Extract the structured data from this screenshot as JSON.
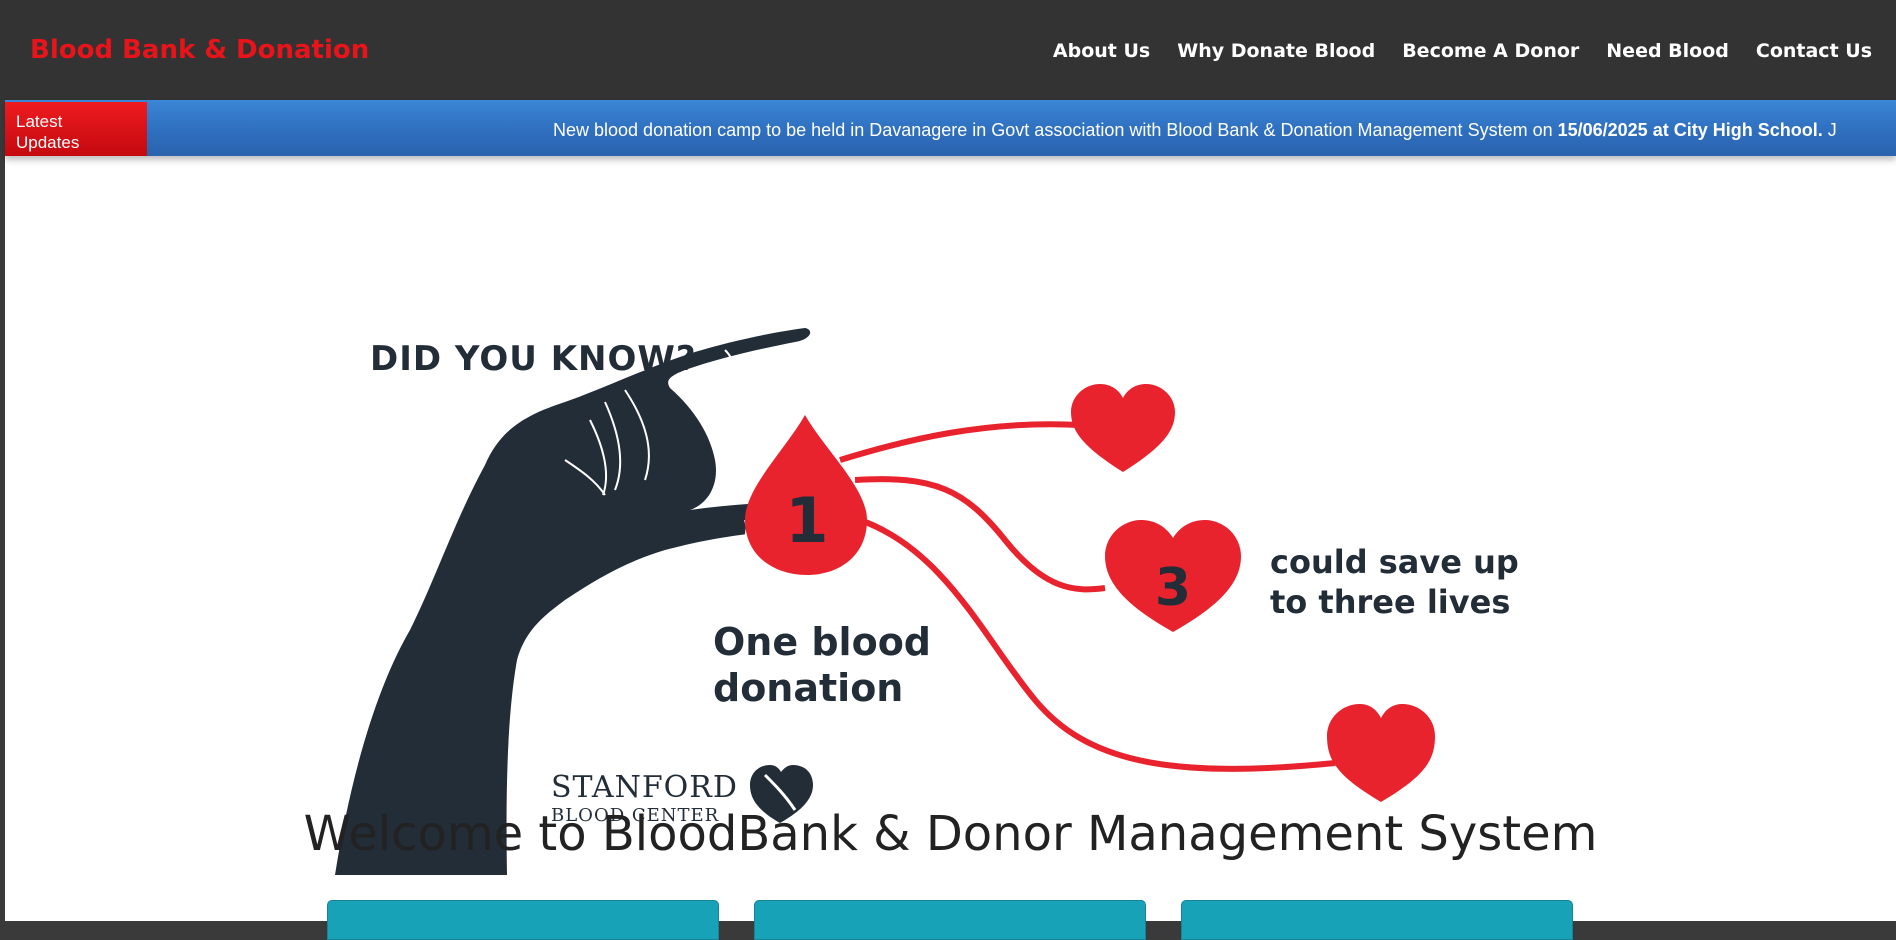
{
  "navbar": {
    "brand": "Blood Bank & Donation",
    "links": [
      "About Us",
      "Why Donate Blood",
      "Become A Donor",
      "Need Blood",
      "Contact Us"
    ]
  },
  "ticker": {
    "label_line1": "Latest",
    "label_line2": "Updates",
    "message": "New blood donation camp to be held in Davanagere in Govt association with Blood Bank & Donation Management System on ",
    "message_bold": "15/06/2025 at City High School.",
    "message_tail": " J"
  },
  "hero": {
    "heading": "DID YOU KNOW?",
    "drop_number": "1",
    "heart_number": "3",
    "caption_line1": "One blood",
    "caption_line2": "donation",
    "save_line1": "could save up",
    "save_line2": "to three lives",
    "logo_line1": "STANFORD",
    "logo_line2": "BLOOD CENTER",
    "colors": {
      "red": "#e8232e",
      "dark": "#232d38"
    }
  },
  "main": {
    "welcome": "Welcome to BloodBank & Donor Management System"
  },
  "theme": {
    "accent_red": "#e8141a",
    "nav_bg": "#333333",
    "ticker_blue": "#2f6fbf",
    "card_teal": "#17a2b8"
  }
}
